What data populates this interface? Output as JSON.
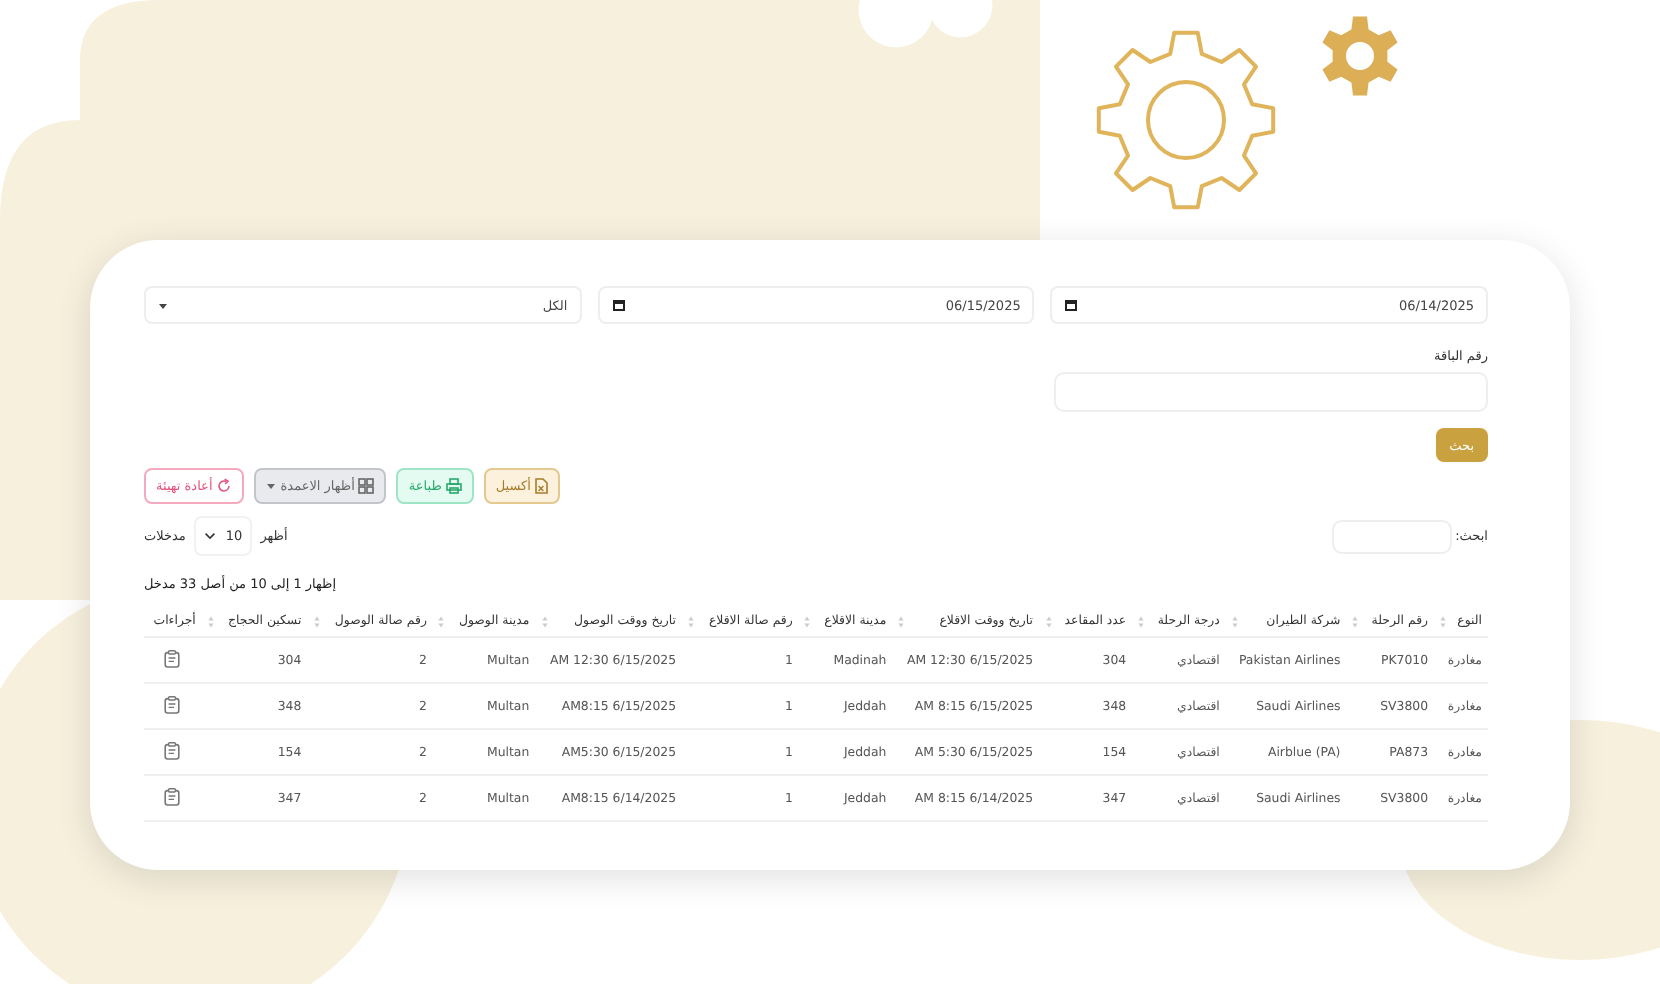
{
  "filters": {
    "date_from": "06/14/2025",
    "date_to": "06/15/2025",
    "select": "الكل"
  },
  "package": {
    "label": "رقم الباقة"
  },
  "search_button": "بحث",
  "export_buttons": [
    {
      "kind": "excel",
      "label": "أكسيل"
    },
    {
      "kind": "print",
      "label": "طباعة"
    },
    {
      "kind": "columns",
      "label": "أظهار الاعمدة"
    },
    {
      "kind": "reset",
      "label": "أعادة تهيئة"
    }
  ],
  "table_search": {
    "label": "ابحث:"
  },
  "page_length": {
    "prefix": "أظهر",
    "value": "10",
    "suffix": "مدخلات"
  },
  "info": "إظهار 1 إلى 10 من أصل 33 مدخل",
  "table": {
    "columns": [
      "النوع",
      "رقم الرحلة",
      "شركة الطيران",
      "درجة الرحلة",
      "عدد المقاعد",
      "تاريخ ووقت الاقلاع",
      "مدينة الاقلاع",
      "رقم صالة الاقلاع",
      "تاريخ ووقت الوصول",
      "مدينة الوصول",
      "رقم صالة الوصول",
      "تسكين الحجاج",
      "أجراءات"
    ],
    "rows": [
      {
        "cells": [
          "مغادرة",
          "PK7010",
          "Pakistan Airlines",
          "اقتصادي",
          "304",
          "AM 12:30 6/15/2025",
          "Madinah",
          "1",
          "AM 12:30 6/15/2025",
          "Multan",
          "2",
          "304"
        ]
      },
      {
        "cells": [
          "مغادرة",
          "SV3800",
          "Saudi Airlines",
          "اقتصادي",
          "348",
          "AM 8:15 6/15/2025",
          "Jeddah",
          "1",
          "AM8:15 6/15/2025",
          "Multan",
          "2",
          "348"
        ]
      },
      {
        "cells": [
          "مغادرة",
          "PA873",
          "Airblue (PA)",
          "اقتصادي",
          "154",
          "AM 5:30 6/15/2025",
          "Jeddah",
          "1",
          "AM5:30 6/15/2025",
          "Multan",
          "2",
          "154"
        ]
      },
      {
        "cells": [
          "مغادرة",
          "SV3800",
          "Saudi Airlines",
          "اقتصادي",
          "347",
          "AM 8:15 6/14/2025",
          "Jeddah",
          "1",
          "AM8:15 6/14/2025",
          "Multan",
          "2",
          "347"
        ]
      }
    ]
  }
}
